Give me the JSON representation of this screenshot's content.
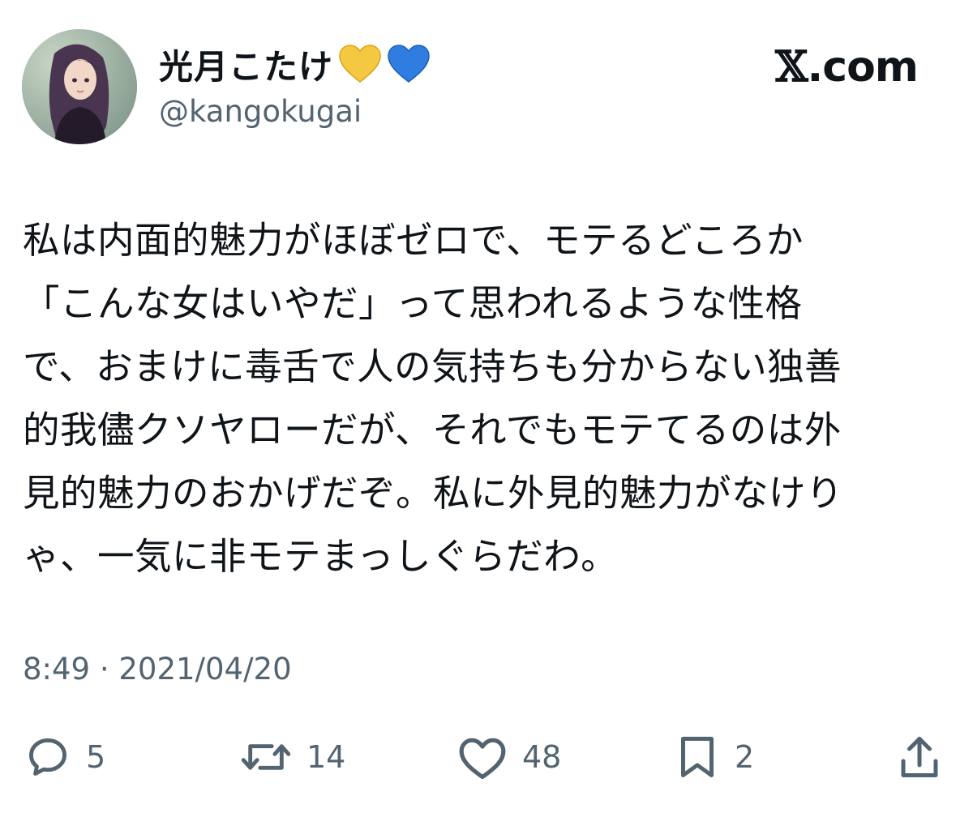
{
  "user": {
    "display_name": "光月こたけ",
    "badges": [
      "yellow-heart",
      "blue-heart"
    ],
    "handle": "@kangokugai"
  },
  "brand": {
    "x_mark": "𝕏",
    "suffix": ".com"
  },
  "tweet": {
    "lines": [
      "私は内面的魅力がほぼゼロで、モテるどころか",
      "「こんな女はいやだ」って思われるような性格",
      "で、おまけに毒舌で人の気持ちも分からない独善",
      "的我儘クソヤローだが、それでもモテてるのは外",
      "見的魅力のおかげだぞ。私に外見的魅力がなけり",
      "ゃ、一気に非モテまっしぐらだわ。"
    ],
    "timestamp": "8:49 · 2021/04/20"
  },
  "actions": {
    "reply": {
      "icon": "reply-icon",
      "count": "5"
    },
    "repost": {
      "icon": "repost-icon",
      "count": "14"
    },
    "like": {
      "icon": "heart-icon",
      "count": "48"
    },
    "bookmark": {
      "icon": "bookmark-icon",
      "count": "2"
    },
    "share": {
      "icon": "share-icon"
    }
  },
  "colors": {
    "text": "#0f1419",
    "secondary": "#536471",
    "yellow_heart": "#f5c842",
    "blue_heart": "#2f7de1"
  }
}
